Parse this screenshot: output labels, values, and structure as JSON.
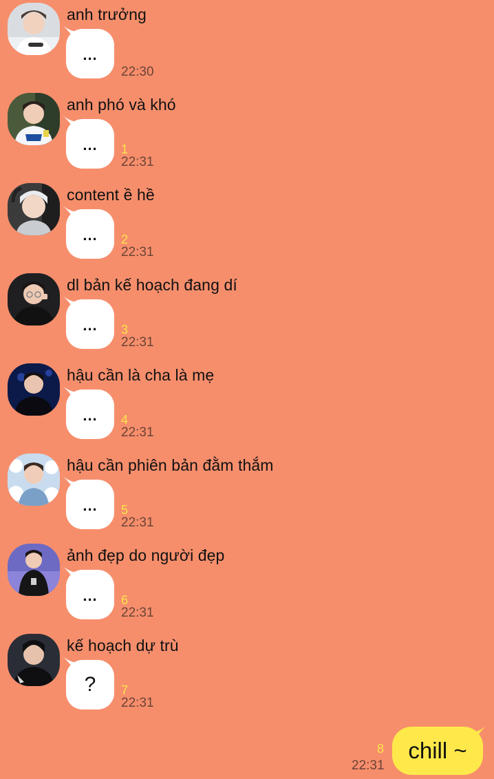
{
  "theme": {
    "background": "#F68E6C",
    "incoming_bubble": "#FFFFFF",
    "outgoing_bubble": "#FFE94A",
    "unread_color": "#FFE54A"
  },
  "messages": [
    {
      "sender": "anh trưởng",
      "text": "...",
      "unread": "",
      "time": "22:30",
      "avatar_icon": "avatar-icon"
    },
    {
      "sender": "anh phó và khó",
      "text": "...",
      "unread": "1",
      "time": "22:31",
      "avatar_icon": "avatar-icon"
    },
    {
      "sender": "content ề hề",
      "text": "...",
      "unread": "2",
      "time": "22:31",
      "avatar_icon": "avatar-icon"
    },
    {
      "sender": "dl bản kế hoạch đang dí",
      "text": "...",
      "unread": "3",
      "time": "22:31",
      "avatar_icon": "avatar-icon"
    },
    {
      "sender": "hậu cần là cha là mẹ",
      "text": "...",
      "unread": "4",
      "time": "22:31",
      "avatar_icon": "avatar-icon"
    },
    {
      "sender": "hậu cần phiên bản đằm thắm",
      "text": "...",
      "unread": "5",
      "time": "22:31",
      "avatar_icon": "avatar-icon"
    },
    {
      "sender": "ảnh đẹp do người đẹp",
      "text": "...",
      "unread": "6",
      "time": "22:31",
      "avatar_icon": "avatar-icon"
    },
    {
      "sender": "kế hoạch dự trù",
      "text": "?",
      "unread": "7",
      "time": "22:31",
      "avatar_icon": "avatar-icon"
    }
  ],
  "outgoing": {
    "text": "chill ~",
    "unread": "8",
    "time": "22:31"
  }
}
